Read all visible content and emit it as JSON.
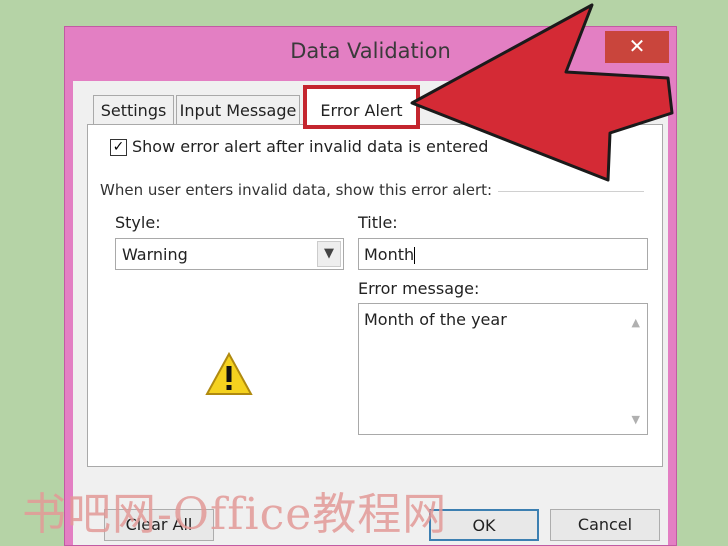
{
  "dialog": {
    "title": "Data Validation",
    "close_glyph": "✕"
  },
  "tabs": [
    {
      "label": "Settings"
    },
    {
      "label": "Input Message"
    },
    {
      "label": "Error Alert",
      "active": true
    }
  ],
  "error_alert": {
    "show_checkbox_label": "Show error alert after invalid data is entered",
    "checked": true,
    "group_label": "When user enters invalid data, show this error alert:",
    "style_label": "Style:",
    "style_value": "Warning",
    "title_label": "Title:",
    "title_value": "Month",
    "message_label": "Error message:",
    "message_value": "Month of the year",
    "icon": "warning-triangle-icon"
  },
  "buttons": {
    "clear_all": "Clear All",
    "ok": "OK",
    "cancel": "Cancel"
  },
  "watermark": "书吧网-Office教程网",
  "colors": {
    "highlight": "#c4252e",
    "arrow": "#d42a35",
    "window_frame": "#e37fc3",
    "background": "#b5d3a6"
  }
}
